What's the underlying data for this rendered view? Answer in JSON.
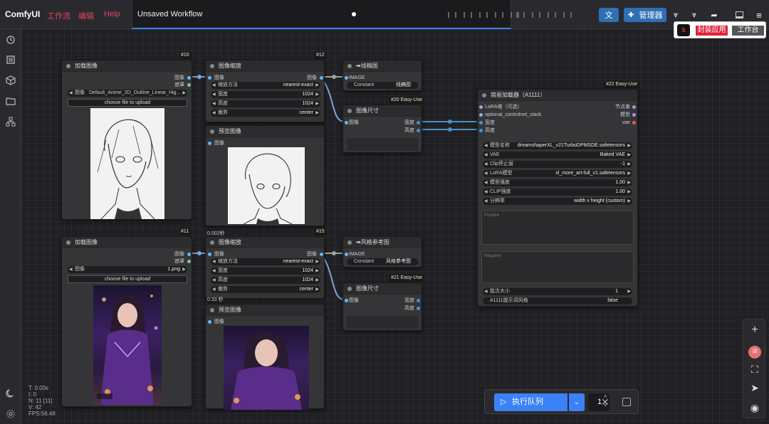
{
  "header": {
    "brand": "ComfyUI",
    "menus": [
      "工作流",
      "编辑",
      "Help"
    ],
    "workflow_title": "Unsaved Workflow",
    "manager_label": "管理器",
    "accent": "#3b82f6",
    "menu_color": "#e0445b"
  },
  "popup": {
    "logo_text": "S",
    "primary_label": "封装应用",
    "secondary_label": "工作台"
  },
  "stats": {
    "t": "T: 0.00s",
    "i": "I: 0",
    "n": "N: 11 [11]",
    "v": "V: 42",
    "fps": "FPS:56.48"
  },
  "nodes": {
    "load1": {
      "badge": "#10",
      "title": "加载图像",
      "out_image": "图像",
      "out_mask": "遮罩",
      "image_label": "图像",
      "image_value": "Default_Anime_2D_Outline_Linear_Hig...",
      "upload_label": "choose file to upload"
    },
    "scale1": {
      "badge": "#12",
      "title": "图像缩放",
      "in_image": "图像",
      "out_image": "图像",
      "w1_l": "缩放方法",
      "w1_r": "nearest-exact",
      "w2_l": "宽度",
      "w2_r": "1024",
      "w3_l": "高度",
      "w3_r": "1024",
      "w4_l": "裁剪",
      "w4_r": "center"
    },
    "preview1": {
      "title": "预览图像",
      "in_image": "图像",
      "timing": "0.002秒"
    },
    "line": {
      "title": "➡线稿图",
      "in_image": "IMAGE",
      "w_l": "Constant",
      "w_r": "线稿图"
    },
    "size1": {
      "badge": "#20 Easy-Use",
      "title": "图像尺寸",
      "in_image": "图像",
      "out_w": "宽度",
      "out_h": "高度"
    },
    "load2": {
      "badge": "#11",
      "title": "加载图像",
      "out_image": "图像",
      "out_mask": "遮罩",
      "image_label": "图像",
      "image_value": "1.png",
      "upload_label": "choose file to upload"
    },
    "scale2": {
      "badge": "#15",
      "title": "图像缩放",
      "in_image": "图像",
      "out_image": "图像",
      "w1_l": "缩放方法",
      "w1_r": "nearest-exact",
      "w2_l": "宽度",
      "w2_r": "1024",
      "w3_l": "高度",
      "w3_r": "1024",
      "w4_l": "裁剪",
      "w4_r": "center"
    },
    "preview2": {
      "title": "预览图像",
      "in_image": "图像",
      "timing": "0.33 秒"
    },
    "style": {
      "title": "➡风格参考图",
      "in_image": "IMAGE",
      "w_l": "Constant",
      "w_r": "风格参考图"
    },
    "size2": {
      "badge": "#21 Easy-Use",
      "title": "图像尺寸",
      "in_image": "图像",
      "out_w": "宽度",
      "out_h": "高度"
    },
    "loader": {
      "badge": "#22 Easy-Use",
      "title": "简易加载器（A1111）",
      "in_lora": "LoRA堆（可选）",
      "in_cn": "optional_controlnet_stack",
      "in_w": "宽度",
      "in_h": "高度",
      "out_pipe": "节点束",
      "out_model": "模型",
      "out_vae": "vae",
      "widgets": [
        {
          "l": "模型名称",
          "r": "dreamshaperXL_v21TurboDPMSDE.safetensors"
        },
        {
          "l": "VAE",
          "r": "Baked VAE"
        },
        {
          "l": "Clip停止层",
          "r": "-1"
        },
        {
          "l": "LoRA模型",
          "r": "xl_more_art-full_v1.safetensors"
        },
        {
          "l": "模型强度",
          "r": "1.00"
        },
        {
          "l": "CLIP强度",
          "r": "1.00"
        },
        {
          "l": "分辨率",
          "r": "width x height (custom)"
        }
      ],
      "positive_placeholder": "Positive",
      "negative_placeholder": "Negative",
      "batch_l": "批次大小",
      "batch_r": "1",
      "a1111_l": "A1111提示词风格",
      "a1111_r": "false"
    }
  },
  "queue": {
    "run_label": "执行队列",
    "count": "1"
  }
}
